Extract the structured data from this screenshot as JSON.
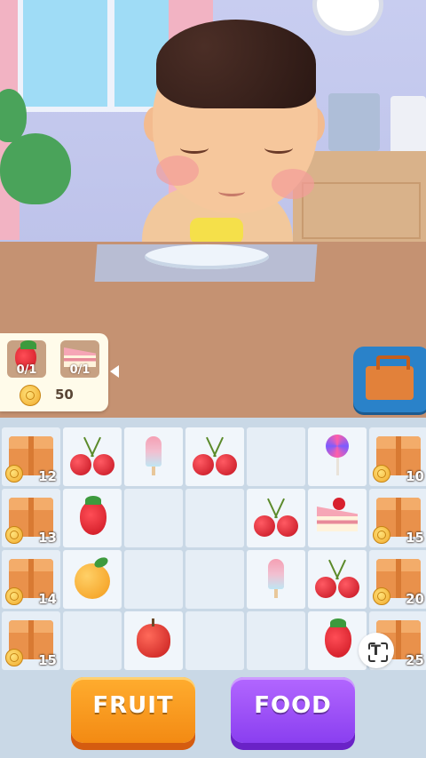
{
  "order": {
    "items": [
      {
        "icon": "strawberry-icon",
        "progress": "0/1"
      },
      {
        "icon": "cake-icon",
        "progress": "0/1"
      }
    ],
    "reward": "50"
  },
  "board": {
    "rows": [
      [
        {
          "type": "crate",
          "count": "12"
        },
        {
          "type": "cherry"
        },
        {
          "type": "popsicle"
        },
        {
          "type": "cherry"
        },
        {
          "type": "empty"
        },
        {
          "type": "lollipop"
        },
        {
          "type": "crate",
          "count": "10"
        }
      ],
      [
        {
          "type": "crate",
          "count": "13"
        },
        {
          "type": "strawberry"
        },
        {
          "type": "empty"
        },
        {
          "type": "empty"
        },
        {
          "type": "cherry"
        },
        {
          "type": "cake"
        },
        {
          "type": "crate",
          "count": "15"
        }
      ],
      [
        {
          "type": "crate",
          "count": "14"
        },
        {
          "type": "orange"
        },
        {
          "type": "empty"
        },
        {
          "type": "empty"
        },
        {
          "type": "popsicle"
        },
        {
          "type": "cherry"
        },
        {
          "type": "crate",
          "count": "20"
        }
      ],
      [
        {
          "type": "crate",
          "count": "15"
        },
        {
          "type": "empty"
        },
        {
          "type": "apple"
        },
        {
          "type": "empty"
        },
        {
          "type": "empty"
        },
        {
          "type": "strawberry"
        },
        {
          "type": "crate",
          "count": "25"
        }
      ]
    ]
  },
  "buttons": {
    "fruit": "FRUIT",
    "food": "FOOD"
  },
  "colors": {
    "fruit_button": "#f38a13",
    "food_button": "#8a3ff0",
    "toolbox_bg": "#2a82c9"
  }
}
